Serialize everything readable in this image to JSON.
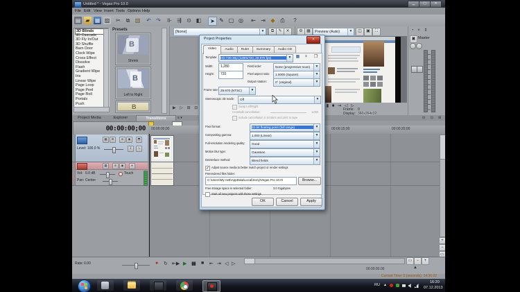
{
  "window": {
    "title": "Untitled * - Vegas Pro 10.0"
  },
  "menu": {
    "items": [
      "File",
      "Edit",
      "View",
      "Insert",
      "Tools",
      "Options",
      "Help"
    ]
  },
  "transitions_panel": {
    "list": [
      "3D Blinds",
      "3D Cascade",
      "3D Fly In/Out",
      "3D Shuffle",
      "Barn Door",
      "Clock Wipe",
      "Cross Effect",
      "Dissolve",
      "Flash",
      "Gradient Wipe",
      "Iris",
      "Linear Wipe",
      "Page Loop",
      "Page Peel",
      "Page Roll",
      "Portals",
      "Push"
    ],
    "presets_label": "Presets",
    "preset_captions": [
      "Shrink",
      "Left to Right"
    ]
  },
  "dock_tabs": {
    "items": [
      "Project Media",
      "Explorer",
      "Transitions"
    ]
  },
  "plugin_panel": {
    "chain_value": "[None]"
  },
  "preview_panel": {
    "quality_value": "Preview (Auto)",
    "frame_label": "Frame:",
    "frame_value": "0",
    "display_label": "Display:",
    "display_value": "360x264x32"
  },
  "master_bus": {
    "label": "Master"
  },
  "dialog": {
    "title": "Project Properties",
    "tabs": [
      "Video",
      "Audio",
      "Ruler",
      "Summary",
      "Audio CD"
    ],
    "template_label": "Template:",
    "template_value": "HD 720-30p (1280x720, 29.970 fps)",
    "width_label": "Width:",
    "width_value": "1,280",
    "height_label": "Height:",
    "height_value": "720",
    "field_order_label": "Field order:",
    "field_order_value": "None (progressive scan)",
    "par_label": "Pixel aspect ratio:",
    "par_value": "1.0000 (Square)",
    "rotation_label": "Output rotation:",
    "rotation_value": "0° (original)",
    "frame_rate_label": "Frame rate:",
    "frame_rate_value": "29.970 (NTSC)",
    "stereo_label": "Stereoscopic 3D mode:",
    "stereo_value": "Off",
    "swap_label": "Swap Left/Right",
    "crosstalk_label": "Crosstalk cancellation:",
    "crosstalk_value": "1.000",
    "include_label": "Include cancellation in renders and print to tape",
    "pixel_format_label": "Pixel format:",
    "pixel_format_value": "32-bit floating point (full range)",
    "gamma_label": "Compositing gamma:",
    "gamma_value": "1.000 (Linear)",
    "quality_label": "Full-resolution rendering quality:",
    "quality_value": "Good",
    "blur_label": "Motion blur type:",
    "blur_value": "Gaussian",
    "deinterlace_label": "Deinterlace method:",
    "deinterlace_value": "Blend fields",
    "adjust_label": "Adjust source media to better match project or render settings",
    "prerender_label": "Prerendered files folder:",
    "folder_value": "C:\\Users\\My nett\\AppData\\Local\\Sony\\Vegas Pro 10.0\\",
    "browse_label": "Browse...",
    "free_space_label": "Free storage space in selected folder:",
    "free_space_value": "3.0 Gigabytes",
    "start_all_label": "Start all new projects with these settings",
    "ok": "OK",
    "cancel": "Cancel",
    "apply": "Apply"
  },
  "timeline": {
    "time_display": "00:00:00;00",
    "ruler_labels": [
      "00:00:00;00",
      "00:00:15;00",
      "00:00:20;00"
    ],
    "video_track": {
      "level_label": "Level:",
      "level_value": "100.0 %"
    },
    "audio_track": {
      "vol_label": "Vol:",
      "vol_value": "0.0 dB",
      "pan_label": "Pan:",
      "pan_value": "Center",
      "automation": "Touch"
    },
    "rate_label": "Rate:",
    "rate_value": "0.00",
    "cursor_time": "00:00:00.00",
    "status_text": "Current Time: 0 (seconds), 14:36:22"
  },
  "taskbar": {
    "lang": "RU",
    "clock_time": "16:20",
    "clock_date": "07.12.2013"
  }
}
